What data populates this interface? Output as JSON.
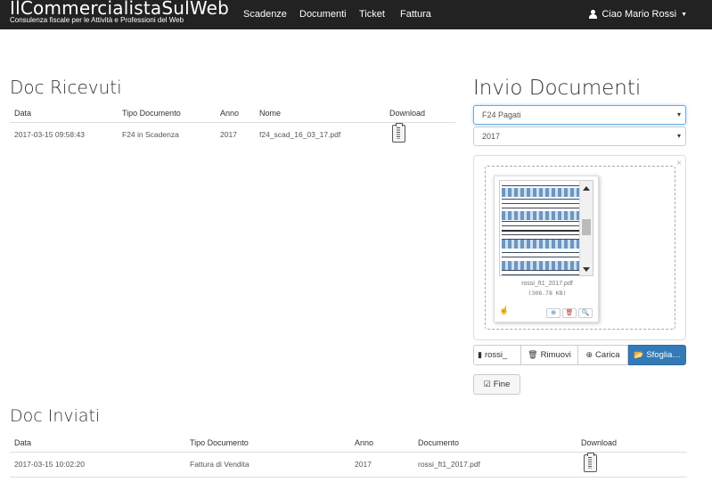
{
  "brand": {
    "title": "IlCommercialistaSulWeb",
    "subtitle": "Consulenza fiscale per le Attività e Professioni del Web"
  },
  "nav": {
    "items": [
      "Scadenze",
      "Documenti",
      "Ticket",
      "Fattura"
    ],
    "user": "Ciao Mario Rossi"
  },
  "ricevuti": {
    "title": "Doc Ricevuti",
    "columns": [
      "Data",
      "Tipo Documento",
      "Anno",
      "Nome",
      "Download"
    ],
    "rows": [
      {
        "data": "2017-03-15 09:58:43",
        "tipo": "F24 in Scadenza",
        "anno": "2017",
        "nome": "f24_scad_16_03_17.pdf"
      }
    ]
  },
  "invio": {
    "title": "Invio Documenti",
    "tipo_selected": "F24 Pagati",
    "anno_selected": "2017",
    "close": "×",
    "file": {
      "name": "rossi_ft1_2017.pdf",
      "size": "(308.78 KB)"
    },
    "buttons": {
      "file": "rossi_",
      "rimuovi": "Rimuovi",
      "carica": "Carica",
      "sfoglia": "Sfoglia…",
      "fine": "Fine"
    }
  },
  "inviati": {
    "title": "Doc Inviati",
    "columns": [
      "Data",
      "Tipo Documento",
      "Anno",
      "Documento",
      "Download"
    ],
    "rows": [
      {
        "data": "2017-03-15 10:02:20",
        "tipo": "Fattura di Vendita",
        "anno": "2017",
        "documento": "rossi_ft1_2017.pdf"
      }
    ]
  },
  "icons": {
    "user": "user-icon",
    "caret": "caret-down-icon",
    "download": "clipboard-download-icon",
    "file": "file-icon",
    "trash": "trash-icon",
    "upload": "upload-icon",
    "folder": "folder-open-icon",
    "check": "check-square-icon",
    "zoom": "zoom-in-icon",
    "drag": "drag-hand-icon"
  },
  "colors": {
    "navbar": "#222222",
    "primary": "#337ab7",
    "focus": "#66afe9"
  }
}
